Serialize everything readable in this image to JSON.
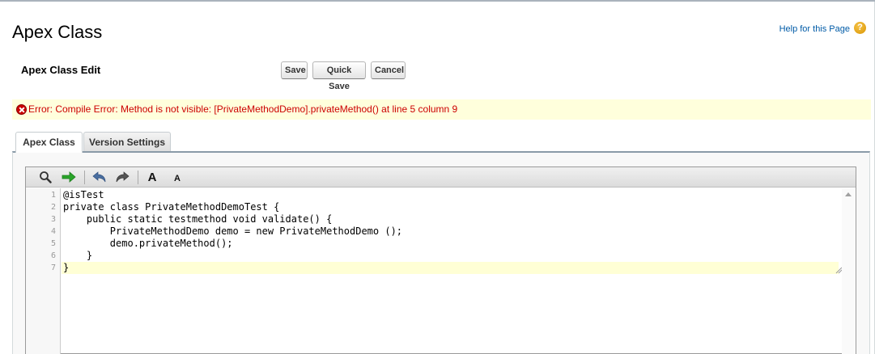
{
  "page": {
    "title": "Apex Class",
    "help_link": "Help for this Page",
    "help_icon": "question-mark-icon"
  },
  "edit_section": {
    "title": "Apex Class Edit",
    "buttons": {
      "save": "Save",
      "quick_save": "Quick Save",
      "cancel": "Cancel"
    }
  },
  "error": {
    "icon": "error-x-icon",
    "message": "Error: Compile Error: Method is not visible: [PrivateMethodDemo].privateMethod() at line 5 column 9",
    "color": "#cc0000"
  },
  "tabs": [
    {
      "label": "Apex Class",
      "active": true
    },
    {
      "label": "Version Settings",
      "active": false
    }
  ],
  "toolbar": {
    "tools": [
      "search-icon",
      "go-to-line-arrow-icon",
      "undo-icon",
      "redo-icon",
      "font-increase-icon",
      "font-decrease-icon"
    ],
    "font_increase_label": "A",
    "font_decrease_label": "A"
  },
  "code": {
    "line_numbers": [
      "1",
      "2",
      "3",
      "4",
      "5",
      "6",
      "7"
    ],
    "lines": [
      "@isTest",
      "private class PrivateMethodDemoTest {",
      "    public static testmethod void validate() {",
      "        PrivateMethodDemo demo = new PrivateMethodDemo ();",
      "        demo.privateMethod();",
      "    }",
      "}"
    ],
    "current_line": 7
  }
}
